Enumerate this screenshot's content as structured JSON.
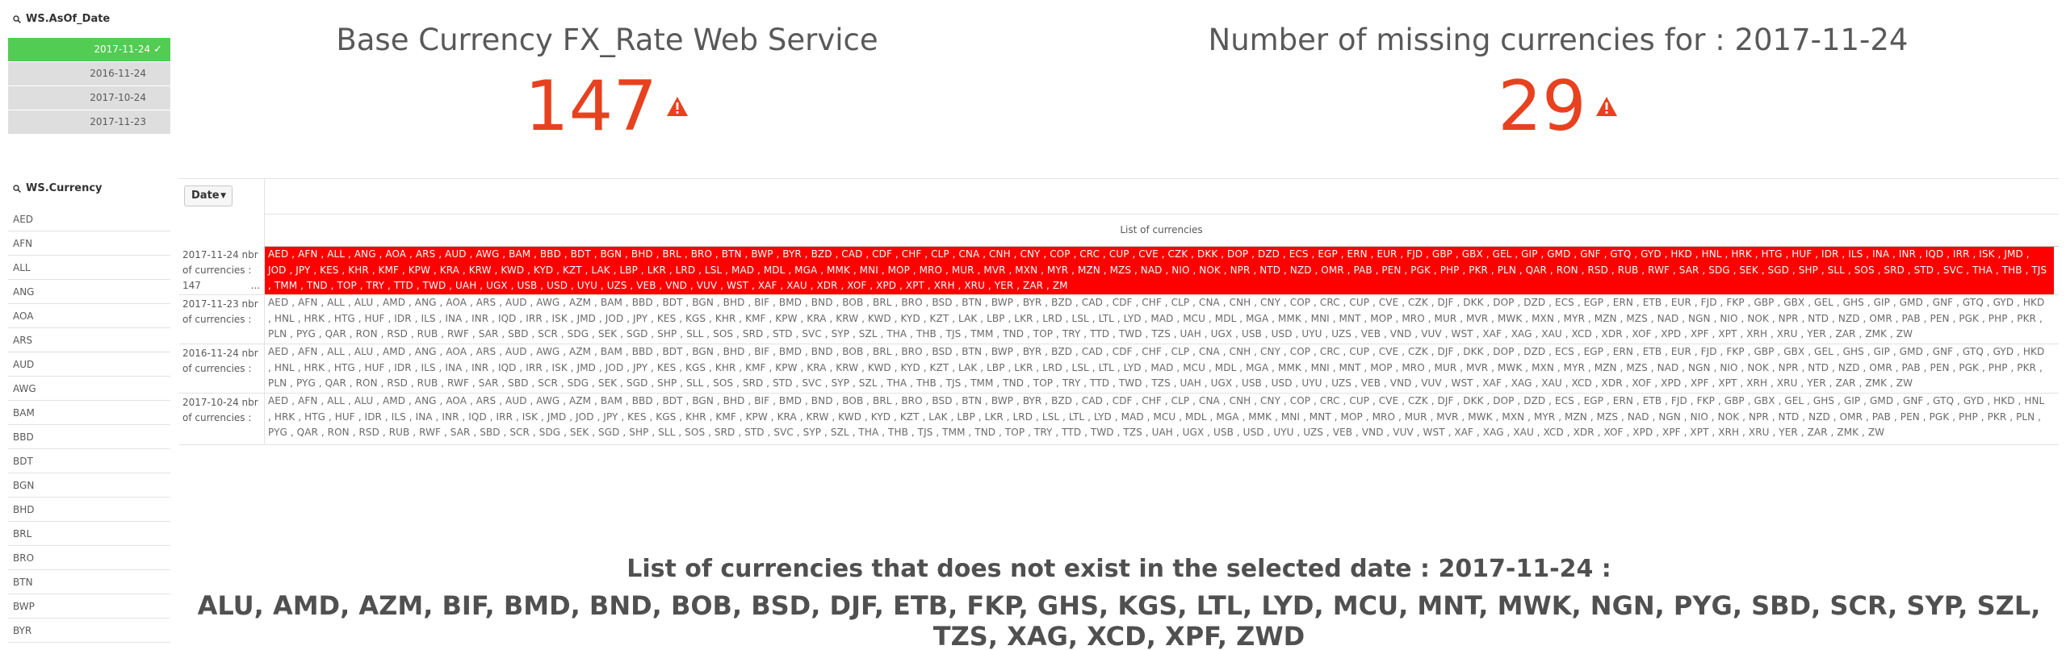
{
  "filters": {
    "date_title": "WS.AsOf_Date",
    "dates": [
      {
        "label": "2017-11-24",
        "selected": true
      },
      {
        "label": "2016-11-24",
        "selected": false
      },
      {
        "label": "2017-10-24",
        "selected": false
      },
      {
        "label": "2017-11-23",
        "selected": false
      }
    ],
    "currency_title": "WS.Currency",
    "currencies": [
      "AED",
      "AFN",
      "ALL",
      "ANG",
      "AOA",
      "ARS",
      "AUD",
      "AWG",
      "BAM",
      "BBD",
      "BDT",
      "BGN",
      "BHD",
      "BRL",
      "BRO",
      "BTN",
      "BWP",
      "BYR"
    ]
  },
  "kpi_left": {
    "title": "Base Currency FX_Rate Web Service",
    "value": "147"
  },
  "kpi_right": {
    "title": "Number of missing currencies for : 2017-11-24",
    "value": "29"
  },
  "table": {
    "dimension_button": "Date",
    "column_header": "List of currencies",
    "rows": [
      {
        "label": "2017-11-24 nbr of currencies : 147",
        "label_line1": "2017-11-24 nbr",
        "label_line2": "of currencies :",
        "label_line3": "147",
        "label_ellipsis": "...",
        "highlighted": true,
        "value": "AED , AFN , ALL , ANG , AOA , ARS , AUD , AWG , BAM , BBD , BDT , BGN , BHD , BRL , BRO , BTN , BWP , BYR , BZD , CAD , CDF , CHF , CLP , CNA , CNH , CNY , COP , CRC , CUP , CVE , CZK , DKK , DOP , DZD , ECS , EGP , ERN , EUR , FJD , GBP , GBX , GEL , GIP , GMD , GNF , GTQ , GYD , HKD , HNL , HRK , HTG , HUF , IDR , ILS , INA , INR , IQD , IRR , ISK , JMD , JOD , JPY , KES , KHR , KMF , KPW , KRA , KRW , KWD , KYD , KZT , LAK , LBP , LKR , LRD , LSL , MAD , MDL , MGA , MMK , MNI , MOP , MRO , MUR , MVR , MXN , MYR , MZN , MZS , NAD , NIO , NOK , NPR , NTD , NZD , OMR , PAB , PEN , PGK , PHP , PKR , PLN , QAR , RON , RSD , RUB , RWF , SAR , SDG , SEK , SGD , SHP , SLL , SOS , SRD , STD , SVC , THA , THB , TJS , TMM , TND , TOP , TRY , TTD , TWD , UAH , UGX , USB , USD , UYU , UZS , VEB , VND , VUV , WST , XAF , XAU , XDR , XOF , XPD , XPT , XRH , XRU , YER , ZAR , ZM"
      },
      {
        "label_line1": "2017-11-23 nbr",
        "label_line2": "of currencies :",
        "highlighted": false,
        "value": "AED , AFN , ALL , ALU , AMD , ANG , AOA , ARS , AUD , AWG , AZM , BAM , BBD , BDT , BGN , BHD , BIF , BMD , BND , BOB , BRL , BRO , BSD , BTN , BWP , BYR , BZD , CAD , CDF , CHF , CLP , CNA , CNH , CNY , COP , CRC , CUP , CVE , CZK , DJF , DKK , DOP , DZD , ECS , EGP , ERN , ETB , EUR , FJD , FKP , GBP , GBX , GEL , GHS , GIP , GMD , GNF , GTQ , GYD , HKD , HNL , HRK , HTG , HUF , IDR , ILS , INA , INR , IQD , IRR , ISK , JMD , JOD , JPY , KES , KGS , KHR , KMF , KPW , KRA , KRW , KWD , KYD , KZT , LAK , LBP , LKR , LRD , LSL , LTL , LYD , MAD , MCU , MDL , MGA , MMK , MNI , MNT , MOP , MRO , MUR , MVR , MWK , MXN , MYR , MZN , MZS , NAD , NGN , NIO , NOK , NPR , NTD , NZD , OMR , PAB , PEN , PGK , PHP , PKR , PLN , PYG , QAR , RON , RSD , RUB , RWF , SAR , SBD , SCR , SDG , SEK , SGD , SHP , SLL , SOS , SRD , STD , SVC , SYP , SZL , THA , THB , TJS , TMM , TND , TOP , TRY , TTD , TWD , TZS , UAH , UGX , USB , USD , UYU , UZS , VEB , VND , VUV , WST , XAF , XAG , XAU , XCD , XDR , XOF , XPD , XPF , XPT , XRH , XRU , YER , ZAR , ZMK , ZW"
      },
      {
        "label_line1": "2016-11-24 nbr",
        "label_line2": "of currencies :",
        "highlighted": false,
        "value": "AED , AFN , ALL , ALU , AMD , ANG , AOA , ARS , AUD , AWG , AZM , BAM , BBD , BDT , BGN , BHD , BIF , BMD , BND , BOB , BRL , BRO , BSD , BTN , BWP , BYR , BZD , CAD , CDF , CHF , CLP , CNA , CNH , CNY , COP , CRC , CUP , CVE , CZK , DJF , DKK , DOP , DZD , ECS , EGP , ERN , ETB , EUR , FJD , FKP , GBP , GBX , GEL , GHS , GIP , GMD , GNF , GTQ , GYD , HKD , HNL , HRK , HTG , HUF , IDR , ILS , INA , INR , IQD , IRR , ISK , JMD , JOD , JPY , KES , KGS , KHR , KMF , KPW , KRA , KRW , KWD , KYD , KZT , LAK , LBP , LKR , LRD , LSL , LTL , LYD , MAD , MCU , MDL , MGA , MMK , MNI , MNT , MOP , MRO , MUR , MVR , MWK , MXN , MYR , MZN , MZS , NAD , NGN , NIO , NOK , NPR , NTD , NZD , OMR , PAB , PEN , PGK , PHP , PKR , PLN , PYG , QAR , RON , RSD , RUB , RWF , SAR , SBD , SCR , SDG , SEK , SGD , SHP , SLL , SOS , SRD , STD , SVC , SYP , SZL , THA , THB , TJS , TMM , TND , TOP , TRY , TTD , TWD , TZS , UAH , UGX , USB , USD , UYU , UZS , VEB , VND , VUV , WST , XAF , XAG , XAU , XCD , XDR , XOF , XPD , XPF , XPT , XRH , XRU , YER , ZAR , ZMK , ZW"
      },
      {
        "label_line1": "2017-10-24 nbr",
        "label_line2": "of currencies :",
        "highlighted": false,
        "value": "AED , AFN , ALL , ALU , AMD , ANG , AOA , ARS , AUD , AWG , AZM , BAM , BBD , BDT , BGN , BHD , BIF , BMD , BND , BOB , BRL , BRO , BSD , BTN , BWP , BYR , BZD , CAD , CDF , CHF , CLP , CNA , CNH , CNY , COP , CRC , CUP , CVE , CZK , DJF , DKK , DOP , DZD , ECS , EGP , ERN , ETB , FJD , FKP , GBP , GBX , GEL , GHS , GIP , GMD , GNF , GTQ , GYD , HKD , HNL , HRK , HTG , HUF , IDR , ILS , INA , INR , IQD , IRR , ISK , JMD , JOD , JPY , KES , KGS , KHR , KMF , KPW , KRA , KRW , KWD , KYD , KZT , LAK , LBP , LKR , LRD , LSL , LTL , LYD , MAD , MCU , MDL , MGA , MMK , MNI , MNT , MOP , MRO , MUR , MVR , MWK , MXN , MYR , MZN , MZS , NAD , NGN , NIO , NOK , NPR , NTD , NZD , OMR , PAB , PEN , PGK , PHP , PKR , PLN , PYG , QAR , RON , RSD , RUB , RWF , SAR , SBD , SCR , SDG , SEK , SGD , SHP , SLL , SOS , SRD , STD , SVC , SYP , SZL , THA , THB , TJS , TMM , TND , TOP , TRY , TTD , TWD , TZS , UAH , UGX , USB , USD , UYU , UZS , VEB , VND , VUV , WST , XAF , XAG , XAU , XCD , XDR , XOF , XPD , XPF , XPT , XRH , XRU , YER , ZAR , ZMK , ZW"
      }
    ]
  },
  "bottom": {
    "title": "List of currencies that does not exist in the selected date : 2017-11-24 :",
    "list": "ALU, AMD, AZM, BIF, BMD, BND, BOB, BSD, DJF, ETB, FKP, GHS, KGS, LTL, LYD, MCU, MNT, MWK, NGN, PYG, SBD, SCR, SYP, SZL, TZS, XAG, XCD, XPF, ZWD"
  },
  "colors": {
    "accent_red": "#e8411f",
    "selected_green": "#52cc52",
    "highlight_red": "#ff0000"
  }
}
